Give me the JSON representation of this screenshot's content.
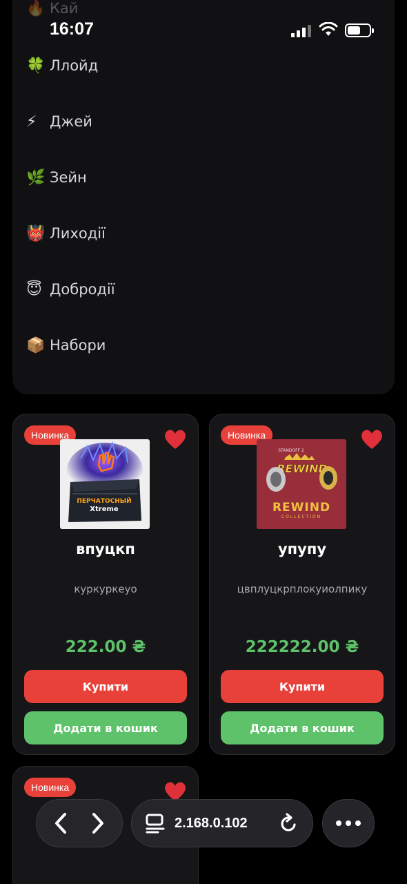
{
  "status_bar": {
    "time": "16:07"
  },
  "menu": {
    "items": [
      {
        "emoji": "🔥",
        "label": "Кай"
      },
      {
        "emoji": "🍀",
        "label": "Ллойд"
      },
      {
        "emoji": "⚡",
        "label": "Джей"
      },
      {
        "emoji": "🌿",
        "label": "Зейн"
      },
      {
        "emoji": "👹",
        "label": "Лиходії"
      },
      {
        "emoji": "😇",
        "label": "Добродії"
      },
      {
        "emoji": "📦",
        "label": "Набори"
      }
    ]
  },
  "products": [
    {
      "badge": "Новинка",
      "title": "впуцкп",
      "description": "куркуркеуо",
      "price": "222.00 ₴",
      "image_text_line1": "ПЕРЧАТОСНЫЙ",
      "image_text_line2": "Xtreme",
      "buy_label": "Купити",
      "cart_label": "Додати в кошик"
    },
    {
      "badge": "Новинка",
      "title": "упупу",
      "description": "цвплуцкрплокуиолпику",
      "price": "222222.00 ₴",
      "image_text_top": "STANDOFF 2",
      "image_text_logo": "REWIND",
      "image_text_main": "REWIND",
      "image_text_sub": "COLLECTION",
      "buy_label": "Купити",
      "cart_label": "Додати в кошик"
    },
    {
      "badge": "Новинка"
    }
  ],
  "browser": {
    "url": "2.168.0.102"
  },
  "colors": {
    "accent_red": "#e8413a",
    "accent_green": "#5ec26a",
    "card_bg": "#161618"
  }
}
